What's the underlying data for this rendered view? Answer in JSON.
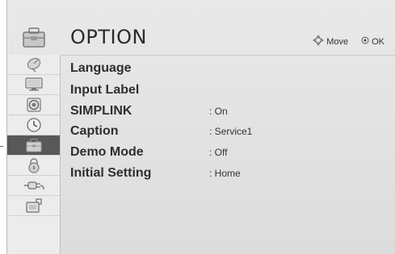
{
  "header": {
    "title": "OPTION",
    "hint_move": "Move",
    "hint_ok": "OK",
    "icons": [
      "move-arrows-icon",
      "ok-circle-icon"
    ]
  },
  "sidebar": {
    "items": [
      {
        "name": "antenna-icon",
        "active": false
      },
      {
        "name": "picture-monitor-icon",
        "active": false
      },
      {
        "name": "speaker-icon",
        "active": false
      },
      {
        "name": "clock-icon",
        "active": false
      },
      {
        "name": "option-toolbox-icon",
        "active": true
      },
      {
        "name": "lock-icon",
        "active": false
      },
      {
        "name": "input-cable-icon",
        "active": false
      },
      {
        "name": "usb-media-icon",
        "active": false
      }
    ]
  },
  "menu": {
    "rows": [
      {
        "label": "Language",
        "value": ""
      },
      {
        "label": "Input Label",
        "value": ""
      },
      {
        "label": "SIMPLINK",
        "value": ": On"
      },
      {
        "label": "Caption",
        "value": ": Service1"
      },
      {
        "label": "Demo Mode",
        "value": ": Off"
      },
      {
        "label": "Initial Setting",
        "value": ": Home"
      }
    ]
  },
  "colors": {
    "background": "#e2e2e2",
    "sidebar_active": "#585858",
    "text": "#2e2e2e"
  }
}
